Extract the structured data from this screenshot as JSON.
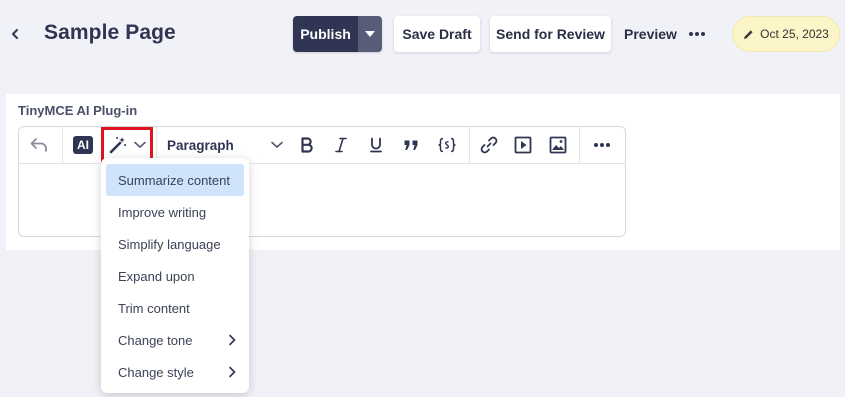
{
  "header": {
    "title": "Sample Page",
    "publish_label": "Publish",
    "save_draft_label": "Save Draft",
    "send_review_label": "Send for Review",
    "preview_label": "Preview",
    "date": "Oct 25, 2023"
  },
  "editor": {
    "section_label": "TinyMCE AI Plug-in",
    "ai_label": "AI",
    "block_format": "Paragraph"
  },
  "ai_menu": {
    "items": [
      {
        "label": "Summarize content"
      },
      {
        "label": "Improve writing"
      },
      {
        "label": "Simplify language"
      },
      {
        "label": "Expand upon"
      },
      {
        "label": "Trim content"
      },
      {
        "label": "Change tone"
      },
      {
        "label": "Change style"
      }
    ]
  },
  "colors": {
    "accent_dark": "#2f3552",
    "highlight_red": "#e0141e",
    "menu_active": "#cfe3fb",
    "date_pill": "#fcf5c7"
  }
}
